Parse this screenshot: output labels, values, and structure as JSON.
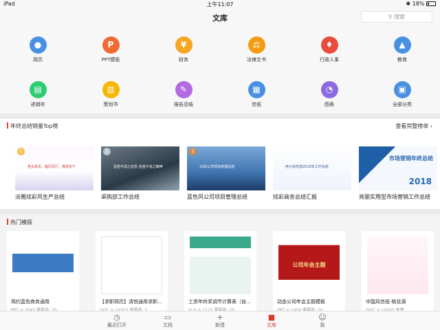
{
  "status": {
    "device": "iPad",
    "time": "上午11:07",
    "battery": "18%"
  },
  "nav": {
    "title": "文库",
    "search_placeholder": "搜索"
  },
  "categories": [
    {
      "label": "简历",
      "icon": "person-icon",
      "color": "#4a90e2",
      "glyph": "●"
    },
    {
      "label": "PPT模板",
      "icon": "ppt-icon",
      "color": "#f06a35",
      "glyph": "P"
    },
    {
      "label": "财务",
      "icon": "yen-icon",
      "color": "#f5a623",
      "glyph": "¥"
    },
    {
      "label": "法律文书",
      "icon": "gavel-icon",
      "color": "#f39c12",
      "glyph": "⚖"
    },
    {
      "label": "行政人事",
      "icon": "tie-icon",
      "color": "#e74c3c",
      "glyph": "♦"
    },
    {
      "label": "教育",
      "icon": "graduation-cap-icon",
      "color": "#4a90e2",
      "glyph": "▲"
    },
    {
      "label": "进销存",
      "icon": "spreadsheet-icon",
      "color": "#2ecc71",
      "glyph": "▤"
    },
    {
      "label": "策划书",
      "icon": "notebook-icon",
      "color": "#f5b700",
      "glyph": "▥"
    },
    {
      "label": "报告总结",
      "icon": "pen-icon",
      "color": "#b36ae2",
      "glyph": "✎"
    },
    {
      "label": "信纸",
      "icon": "document-icon",
      "color": "#4a90e2",
      "glyph": "▦"
    },
    {
      "label": "图表",
      "icon": "pie-chart-icon",
      "color": "#8e6ae2",
      "glyph": "◔"
    },
    {
      "label": "全部分类",
      "icon": "grid-icon",
      "color": "#4a90e2",
      "glyph": "▣"
    }
  ],
  "top_section": {
    "title": "年终总结销量Top榜",
    "more": "查看完整榜单 ›",
    "items": [
      {
        "caption": "淡雅炫彩风生产总结",
        "thumb_text": "各负其责、履历风行、真抓实干",
        "rank": "1"
      },
      {
        "caption": "采购部工作总结",
        "thumb_text": "坚若不渝之信念 自强不息之精神",
        "rank": "2"
      },
      {
        "caption": "蓝色风公司项目管理总结",
        "thumb_text": "19年公司项目管理总结",
        "rank": "3"
      },
      {
        "caption": "炫彩商务总结汇报",
        "thumb_text": "电子商务部2018年工作总结",
        "rank": ""
      },
      {
        "caption": "亮丽实用型市场营销工作总结",
        "thumb_text": "市场营销年终总结",
        "rank": "",
        "year": "2018"
      }
    ]
  },
  "hot_section": {
    "title": "热门模版",
    "items": [
      {
        "caption": "简约蓝色商务通用",
        "meta": "PPT  ◎ 2043    需要券: 20"
      },
      {
        "caption": "【求职简历】清悦通用求职...",
        "meta": "DOC  ◎ 10203    需要券: 5"
      },
      {
        "caption": "工资年终奖调节计算表（自...",
        "meta": "XLS  ◎ 2172    需要券: 20"
      },
      {
        "caption": "动态公司年会主题模板",
        "meta": "PPT  ◎ 1456    需要券: 20",
        "thumb_text": "公司年会主题"
      },
      {
        "caption": "中国风信纸-桃花源",
        "meta": "DOC  ◎ 10205    免费"
      }
    ]
  },
  "tabs": [
    {
      "label": "最近打开",
      "icon": "clock-icon",
      "glyph": "◷"
    },
    {
      "label": "文档",
      "icon": "folder-icon",
      "glyph": "▭"
    },
    {
      "label": "新建",
      "icon": "plus-icon",
      "glyph": "+"
    },
    {
      "label": "文库",
      "icon": "library-icon",
      "glyph": "■",
      "active": true
    },
    {
      "label": "我",
      "icon": "profile-icon",
      "glyph": "☺"
    }
  ]
}
